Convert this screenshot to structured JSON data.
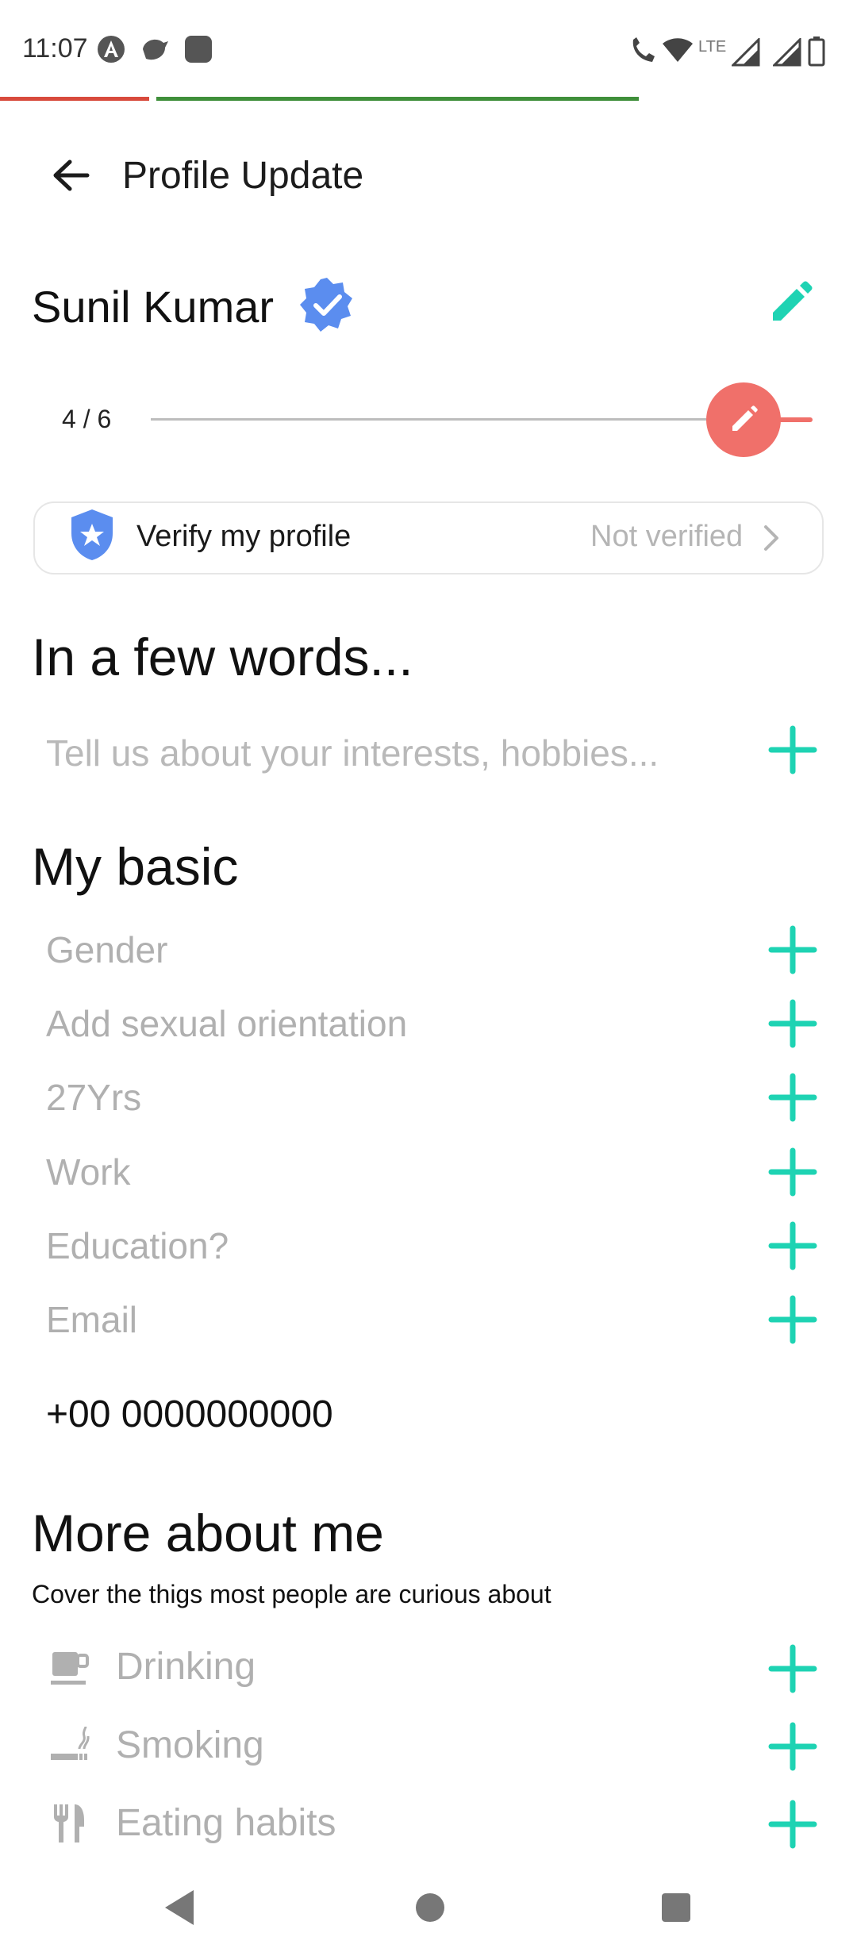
{
  "status_bar": {
    "time": "11:07",
    "network": "LTE"
  },
  "header": {
    "title": "Profile Update"
  },
  "profile": {
    "name": "Sunil Kumar",
    "progress_text": "4 / 6",
    "progress_fraction": 0.667
  },
  "verify": {
    "label": "Verify my profile",
    "status": "Not verified"
  },
  "about": {
    "heading": "In a few words...",
    "placeholder": "Tell us about your interests, hobbies..."
  },
  "basic": {
    "heading": "My basic",
    "items": [
      "Gender",
      "Add sexual orientation",
      "27Yrs",
      "Work",
      "Education?",
      "Email"
    ],
    "phone": "+00 0000000000"
  },
  "more": {
    "heading": "More about me",
    "subtitle": "Cover the thigs most people are curious about",
    "items": [
      {
        "label": "Drinking",
        "icon": "coffee-cup-icon"
      },
      {
        "label": "Smoking",
        "icon": "smoking-icon"
      },
      {
        "label": "Eating habits",
        "icon": "restaurant-icon"
      }
    ]
  },
  "colors": {
    "accent": "#1ed3b3",
    "coral": "#f0706a",
    "verified_blue": "#5b8def"
  },
  "nav": {
    "back": "back-triangle-icon",
    "home": "home-circle-icon",
    "recents": "recents-square-icon"
  }
}
